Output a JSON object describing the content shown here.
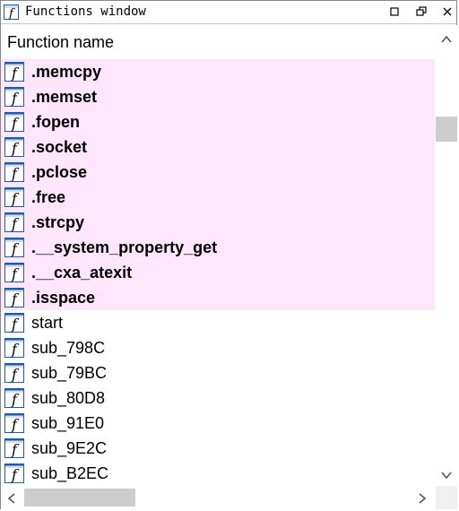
{
  "window": {
    "title": "Functions window",
    "icon": "function-f-icon"
  },
  "controls": [
    "restore-box-icon",
    "float-icon",
    "close-icon"
  ],
  "header": {
    "column_label": "Function name"
  },
  "colors": {
    "library_row_bg": "#ffe6fb",
    "icon_blue": "#1e5ba8",
    "scroll_thumb": "#cdcdcd"
  },
  "functions": [
    {
      "name": ".memcpy",
      "library": true
    },
    {
      "name": ".memset",
      "library": true
    },
    {
      "name": ".fopen",
      "library": true
    },
    {
      "name": ".socket",
      "library": true
    },
    {
      "name": ".pclose",
      "library": true
    },
    {
      "name": ".free",
      "library": true
    },
    {
      "name": ".strcpy",
      "library": true
    },
    {
      "name": ".__system_property_get",
      "library": true
    },
    {
      "name": ".__cxa_atexit",
      "library": true
    },
    {
      "name": ".isspace",
      "library": true
    },
    {
      "name": "start",
      "library": false
    },
    {
      "name": "sub_798C",
      "library": false
    },
    {
      "name": "sub_79BC",
      "library": false
    },
    {
      "name": "sub_80D8",
      "library": false
    },
    {
      "name": "sub_91E0",
      "library": false
    },
    {
      "name": "sub_9E2C",
      "library": false
    },
    {
      "name": "sub_B2EC",
      "library": false
    }
  ]
}
